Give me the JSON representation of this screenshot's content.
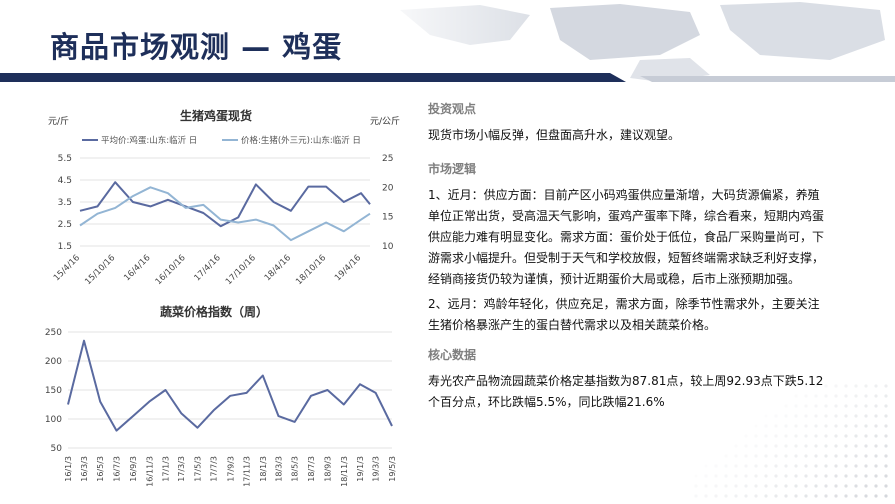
{
  "title": "商品市场观测 — 鸡蛋",
  "colors": {
    "title": "#1e2f5a",
    "series_dark": "#5a6aa0",
    "series_light": "#93b5d4",
    "section_head": "#7f7f7f"
  },
  "chart_top": {
    "title": "生猪鸡蛋现货",
    "left_unit": "元/斤",
    "right_unit": "元/公斤",
    "legend": [
      "平均价:鸡蛋:山东:临沂 日",
      "价格:生猪(外三元):山东:临沂 日"
    ],
    "left_ticks": [
      "5.5",
      "4.5",
      "3.5",
      "2.5",
      "1.5"
    ],
    "right_ticks": [
      "25",
      "20",
      "15",
      "10"
    ],
    "x_ticks": [
      "15/4/16",
      "15/10/16",
      "16/4/16",
      "16/10/16",
      "17/4/16",
      "17/10/16",
      "18/4/16",
      "18/10/16",
      "19/4/16"
    ]
  },
  "chart_bottom": {
    "title": "蔬菜价格指数（周）",
    "y_ticks": [
      "250",
      "200",
      "150",
      "100",
      "50"
    ],
    "x_ticks": [
      "16/1/3",
      "16/3/3",
      "16/5/3",
      "16/7/3",
      "16/9/3",
      "16/11/3",
      "17/1/3",
      "17/3/3",
      "17/5/3",
      "17/7/3",
      "17/9/3",
      "17/11/3",
      "18/1/3",
      "18/3/3",
      "18/5/3",
      "18/7/3",
      "18/9/3",
      "18/11/3",
      "19/1/3",
      "19/3/3",
      "19/5/3"
    ]
  },
  "chart_data": [
    {
      "type": "line",
      "title": "生猪鸡蛋现货",
      "ylabel": "元/斤",
      "y2label": "元/公斤",
      "ylim": [
        1.5,
        5.5
      ],
      "y2lim": [
        10,
        25
      ],
      "x": [
        "2015-04-16",
        "2015-07-16",
        "2015-10-16",
        "2016-01-16",
        "2016-04-16",
        "2016-07-16",
        "2016-10-16",
        "2017-01-16",
        "2017-04-16",
        "2017-07-16",
        "2017-10-16",
        "2018-01-16",
        "2018-04-16",
        "2018-07-16",
        "2018-10-16",
        "2019-01-16",
        "2019-04-16",
        "2019-06-01"
      ],
      "series": [
        {
          "name": "平均价:鸡蛋:山东:临沂 日",
          "axis": "left",
          "values": [
            3.1,
            3.3,
            4.4,
            3.5,
            3.3,
            3.6,
            3.3,
            3.0,
            2.4,
            2.8,
            4.3,
            3.5,
            3.1,
            4.2,
            4.2,
            3.5,
            3.9,
            3.4
          ]
        },
        {
          "name": "价格:生猪(外三元):山东:临沂 日",
          "axis": "right",
          "values": [
            13.5,
            15.5,
            16.5,
            18.5,
            20.0,
            19.0,
            16.5,
            17.0,
            14.5,
            14.0,
            14.5,
            13.5,
            11.0,
            12.5,
            14.0,
            12.5,
            14.5,
            15.5
          ]
        }
      ]
    },
    {
      "type": "line",
      "title": "蔬菜价格指数（周）",
      "ylim": [
        50,
        250
      ],
      "x": [
        "2016-01-03",
        "2016-03-03",
        "2016-05-03",
        "2016-07-03",
        "2016-09-03",
        "2016-11-03",
        "2017-01-03",
        "2017-03-03",
        "2017-05-03",
        "2017-07-03",
        "2017-09-03",
        "2017-11-03",
        "2018-01-03",
        "2018-03-03",
        "2018-05-03",
        "2018-07-03",
        "2018-09-03",
        "2018-11-03",
        "2019-01-03",
        "2019-03-03",
        "2019-05-03"
      ],
      "series": [
        {
          "name": "蔬菜价格指数",
          "values": [
            125,
            235,
            130,
            80,
            105,
            130,
            150,
            110,
            85,
            115,
            140,
            145,
            175,
            105,
            95,
            140,
            150,
            125,
            160,
            145,
            88
          ]
        }
      ]
    }
  ],
  "right": {
    "sections": [
      {
        "head": "投资观点",
        "paras": [
          "现货市场小幅反弹，但盘面高升水，建议观望。"
        ]
      },
      {
        "head": "市场逻辑",
        "paras": [
          "1、近月：供应方面：目前产区小码鸡蛋供应量渐增，大码货源偏紧，养殖单位正常出货，受高温天气影响，蛋鸡产蛋率下降，综合看来，短期内鸡蛋供应能力难有明显变化。需求方面：蛋价处于低位，食品厂采购量尚可，下游需求小幅提升。但受制于天气和学校放假，短暂终端需求缺乏利好支撑，经销商接货仍较为谨慎，预计近期蛋价大局或稳，后市上涨预期加强。",
          "2、远月：鸡龄年轻化，供应充足，需求方面，除季节性需求外，主要关注生猪价格暴涨产生的蛋白替代需求以及相关蔬菜价格。"
        ]
      },
      {
        "head": "核心数据",
        "paras": [
          "寿光农产品物流园蔬菜价格定基指数为87.81点，较上周92.93点下跌5.12个百分点，环比跌幅5.5%，同比跌幅21.6%"
        ]
      }
    ]
  }
}
